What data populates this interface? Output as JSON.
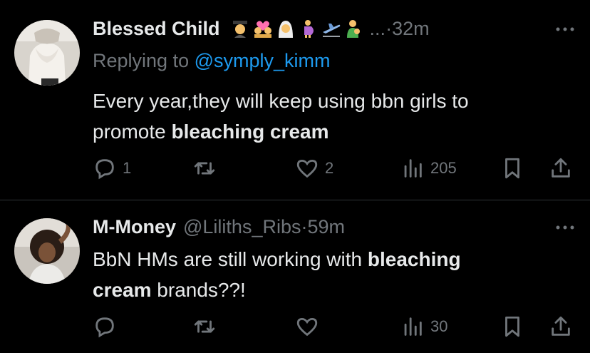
{
  "tweets": [
    {
      "name": "Blessed Child",
      "emoji_icons": [
        "woman-graduate-emoji",
        "couple-heart-emoji",
        "bride-with-veil-emoji",
        "pregnant-woman-emoji",
        "airplane-departure-emoji",
        "woman-feeding-baby-emoji"
      ],
      "ellipsis": "...",
      "sep": "·",
      "time": "32m",
      "replying_prefix": "Replying to ",
      "replying_handle": "@symply_kimm",
      "text_line1": "Every year,they will keep using bbn girls to",
      "text_line2_plain": "promote ",
      "text_line2_bold": "bleaching cream",
      "stats": {
        "replies": "1",
        "retweets": "",
        "likes": "2",
        "views": "205"
      }
    },
    {
      "name": "M-Money",
      "handle": "@Liliths_Ribs",
      "sep": "·",
      "time": "59m",
      "text_line1_plain": "BbN HMs are still working with ",
      "text_line1_bold": "bleaching",
      "text_line2_bold": "cream",
      "text_line2_plain": " brands??!",
      "stats": {
        "replies": "",
        "retweets": "",
        "likes": "",
        "views": "30"
      }
    }
  ],
  "colors": {
    "background": "#000000",
    "text": "#e7e9ea",
    "muted": "#71767b",
    "link": "#1d9bf0",
    "divider": "#2f3336"
  }
}
